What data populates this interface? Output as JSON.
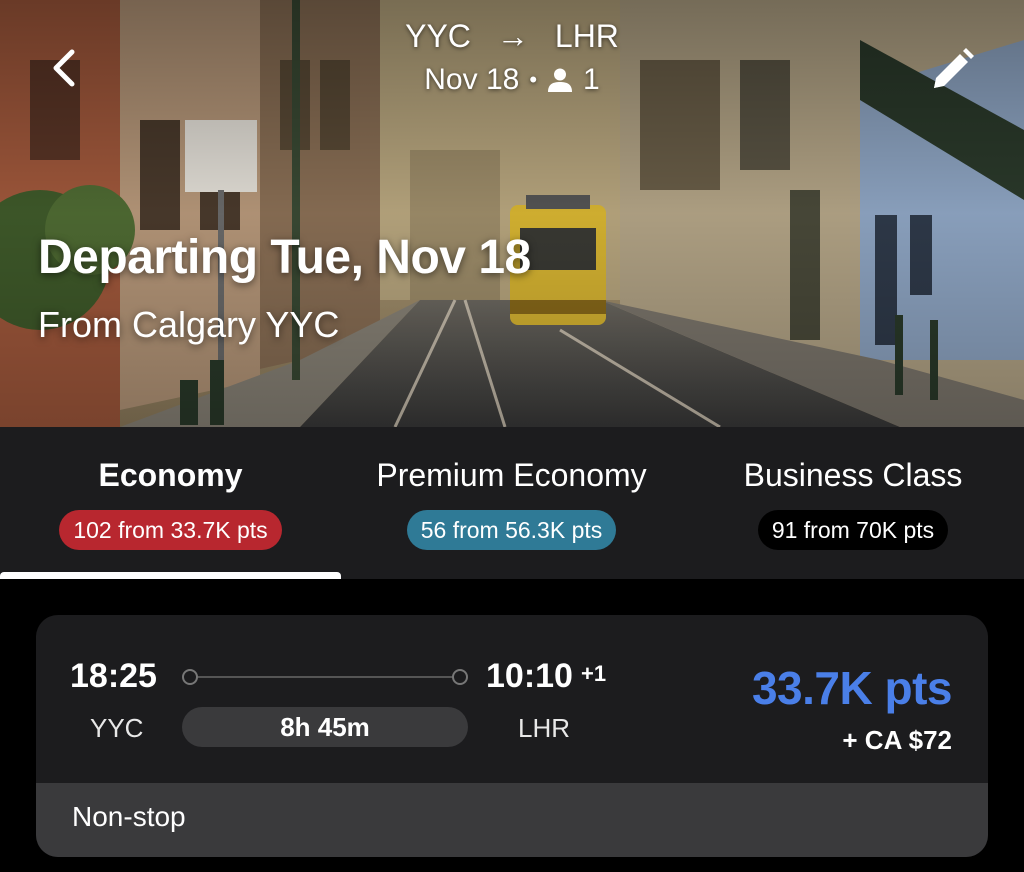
{
  "header": {
    "origin": "YYC",
    "arrow": "→",
    "destination": "LHR",
    "date": "Nov 18",
    "separator": "•",
    "passengers": "1"
  },
  "hero": {
    "title": "Departing Tue, Nov 18",
    "subtitle": "From Calgary YYC"
  },
  "tabs": [
    {
      "label": "Economy",
      "badge": "102 from 33.7K pts",
      "badge_color": "#b8272f",
      "active": true
    },
    {
      "label": "Premium Economy",
      "badge": "56 from 56.3K pts",
      "badge_color": "#2f7a96",
      "active": false
    },
    {
      "label": "Business Class",
      "badge": "91 from 70K pts",
      "badge_color": "#000000",
      "active": false
    }
  ],
  "flight": {
    "depart_time": "18:25",
    "depart_code": "YYC",
    "duration": "8h 45m",
    "arrive_time": "10:10",
    "arrive_day_offset": "+1",
    "arrive_code": "LHR",
    "price": "33.7K pts",
    "price_color": "#4a7fe8",
    "tax": "+ CA $72",
    "stops": "Non-stop"
  },
  "icons": {
    "back": "chevron-left-icon",
    "edit": "pencil-icon",
    "passenger": "person-icon"
  }
}
